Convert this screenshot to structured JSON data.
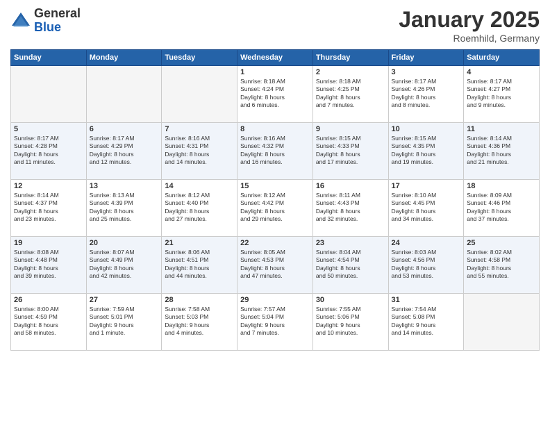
{
  "logo": {
    "general": "General",
    "blue": "Blue"
  },
  "title": "January 2025",
  "location": "Roemhild, Germany",
  "days_header": [
    "Sunday",
    "Monday",
    "Tuesday",
    "Wednesday",
    "Thursday",
    "Friday",
    "Saturday"
  ],
  "weeks": [
    [
      {
        "day": "",
        "info": ""
      },
      {
        "day": "",
        "info": ""
      },
      {
        "day": "",
        "info": ""
      },
      {
        "day": "1",
        "info": "Sunrise: 8:18 AM\nSunset: 4:24 PM\nDaylight: 8 hours\nand 6 minutes."
      },
      {
        "day": "2",
        "info": "Sunrise: 8:18 AM\nSunset: 4:25 PM\nDaylight: 8 hours\nand 7 minutes."
      },
      {
        "day": "3",
        "info": "Sunrise: 8:17 AM\nSunset: 4:26 PM\nDaylight: 8 hours\nand 8 minutes."
      },
      {
        "day": "4",
        "info": "Sunrise: 8:17 AM\nSunset: 4:27 PM\nDaylight: 8 hours\nand 9 minutes."
      }
    ],
    [
      {
        "day": "5",
        "info": "Sunrise: 8:17 AM\nSunset: 4:28 PM\nDaylight: 8 hours\nand 11 minutes."
      },
      {
        "day": "6",
        "info": "Sunrise: 8:17 AM\nSunset: 4:29 PM\nDaylight: 8 hours\nand 12 minutes."
      },
      {
        "day": "7",
        "info": "Sunrise: 8:16 AM\nSunset: 4:31 PM\nDaylight: 8 hours\nand 14 minutes."
      },
      {
        "day": "8",
        "info": "Sunrise: 8:16 AM\nSunset: 4:32 PM\nDaylight: 8 hours\nand 16 minutes."
      },
      {
        "day": "9",
        "info": "Sunrise: 8:15 AM\nSunset: 4:33 PM\nDaylight: 8 hours\nand 17 minutes."
      },
      {
        "day": "10",
        "info": "Sunrise: 8:15 AM\nSunset: 4:35 PM\nDaylight: 8 hours\nand 19 minutes."
      },
      {
        "day": "11",
        "info": "Sunrise: 8:14 AM\nSunset: 4:36 PM\nDaylight: 8 hours\nand 21 minutes."
      }
    ],
    [
      {
        "day": "12",
        "info": "Sunrise: 8:14 AM\nSunset: 4:37 PM\nDaylight: 8 hours\nand 23 minutes."
      },
      {
        "day": "13",
        "info": "Sunrise: 8:13 AM\nSunset: 4:39 PM\nDaylight: 8 hours\nand 25 minutes."
      },
      {
        "day": "14",
        "info": "Sunrise: 8:12 AM\nSunset: 4:40 PM\nDaylight: 8 hours\nand 27 minutes."
      },
      {
        "day": "15",
        "info": "Sunrise: 8:12 AM\nSunset: 4:42 PM\nDaylight: 8 hours\nand 29 minutes."
      },
      {
        "day": "16",
        "info": "Sunrise: 8:11 AM\nSunset: 4:43 PM\nDaylight: 8 hours\nand 32 minutes."
      },
      {
        "day": "17",
        "info": "Sunrise: 8:10 AM\nSunset: 4:45 PM\nDaylight: 8 hours\nand 34 minutes."
      },
      {
        "day": "18",
        "info": "Sunrise: 8:09 AM\nSunset: 4:46 PM\nDaylight: 8 hours\nand 37 minutes."
      }
    ],
    [
      {
        "day": "19",
        "info": "Sunrise: 8:08 AM\nSunset: 4:48 PM\nDaylight: 8 hours\nand 39 minutes."
      },
      {
        "day": "20",
        "info": "Sunrise: 8:07 AM\nSunset: 4:49 PM\nDaylight: 8 hours\nand 42 minutes."
      },
      {
        "day": "21",
        "info": "Sunrise: 8:06 AM\nSunset: 4:51 PM\nDaylight: 8 hours\nand 44 minutes."
      },
      {
        "day": "22",
        "info": "Sunrise: 8:05 AM\nSunset: 4:53 PM\nDaylight: 8 hours\nand 47 minutes."
      },
      {
        "day": "23",
        "info": "Sunrise: 8:04 AM\nSunset: 4:54 PM\nDaylight: 8 hours\nand 50 minutes."
      },
      {
        "day": "24",
        "info": "Sunrise: 8:03 AM\nSunset: 4:56 PM\nDaylight: 8 hours\nand 53 minutes."
      },
      {
        "day": "25",
        "info": "Sunrise: 8:02 AM\nSunset: 4:58 PM\nDaylight: 8 hours\nand 55 minutes."
      }
    ],
    [
      {
        "day": "26",
        "info": "Sunrise: 8:00 AM\nSunset: 4:59 PM\nDaylight: 8 hours\nand 58 minutes."
      },
      {
        "day": "27",
        "info": "Sunrise: 7:59 AM\nSunset: 5:01 PM\nDaylight: 9 hours\nand 1 minute."
      },
      {
        "day": "28",
        "info": "Sunrise: 7:58 AM\nSunset: 5:03 PM\nDaylight: 9 hours\nand 4 minutes."
      },
      {
        "day": "29",
        "info": "Sunrise: 7:57 AM\nSunset: 5:04 PM\nDaylight: 9 hours\nand 7 minutes."
      },
      {
        "day": "30",
        "info": "Sunrise: 7:55 AM\nSunset: 5:06 PM\nDaylight: 9 hours\nand 10 minutes."
      },
      {
        "day": "31",
        "info": "Sunrise: 7:54 AM\nSunset: 5:08 PM\nDaylight: 9 hours\nand 14 minutes."
      },
      {
        "day": "",
        "info": ""
      }
    ]
  ]
}
